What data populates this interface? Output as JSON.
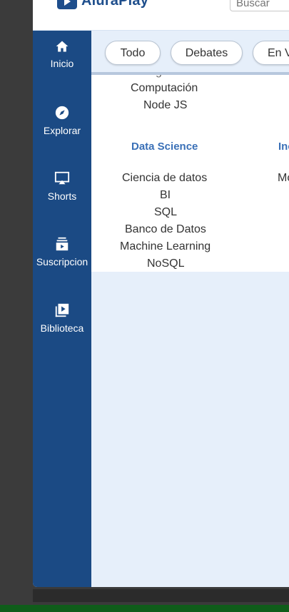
{
  "header": {
    "brand": "AluraPlay",
    "search_placeholder": "Buscar"
  },
  "sidebar": {
    "items": [
      {
        "label": "Inicio",
        "icon": "home-icon"
      },
      {
        "label": "Explorar",
        "icon": "compass-icon"
      },
      {
        "label": "Shorts",
        "icon": "airplay-icon"
      },
      {
        "label": "Suscripcion",
        "icon": "subscriptions-icon"
      },
      {
        "label": "Biblioteca",
        "icon": "library-icon"
      }
    ]
  },
  "chips": [
    "Todo",
    "Debates",
    "En V"
  ],
  "columns": [
    {
      "title": "",
      "items": [
        "Computación",
        "Node JS"
      ]
    },
    {
      "title": "Data Science",
      "items": [
        "Ciencia de datos",
        "BI",
        "SQL",
        "Banco de Datos",
        "Machine Learning",
        "NoSQL"
      ]
    },
    {
      "title": "Inc",
      "items": [
        "Mc"
      ]
    }
  ],
  "partial_clipped_text": "g"
}
